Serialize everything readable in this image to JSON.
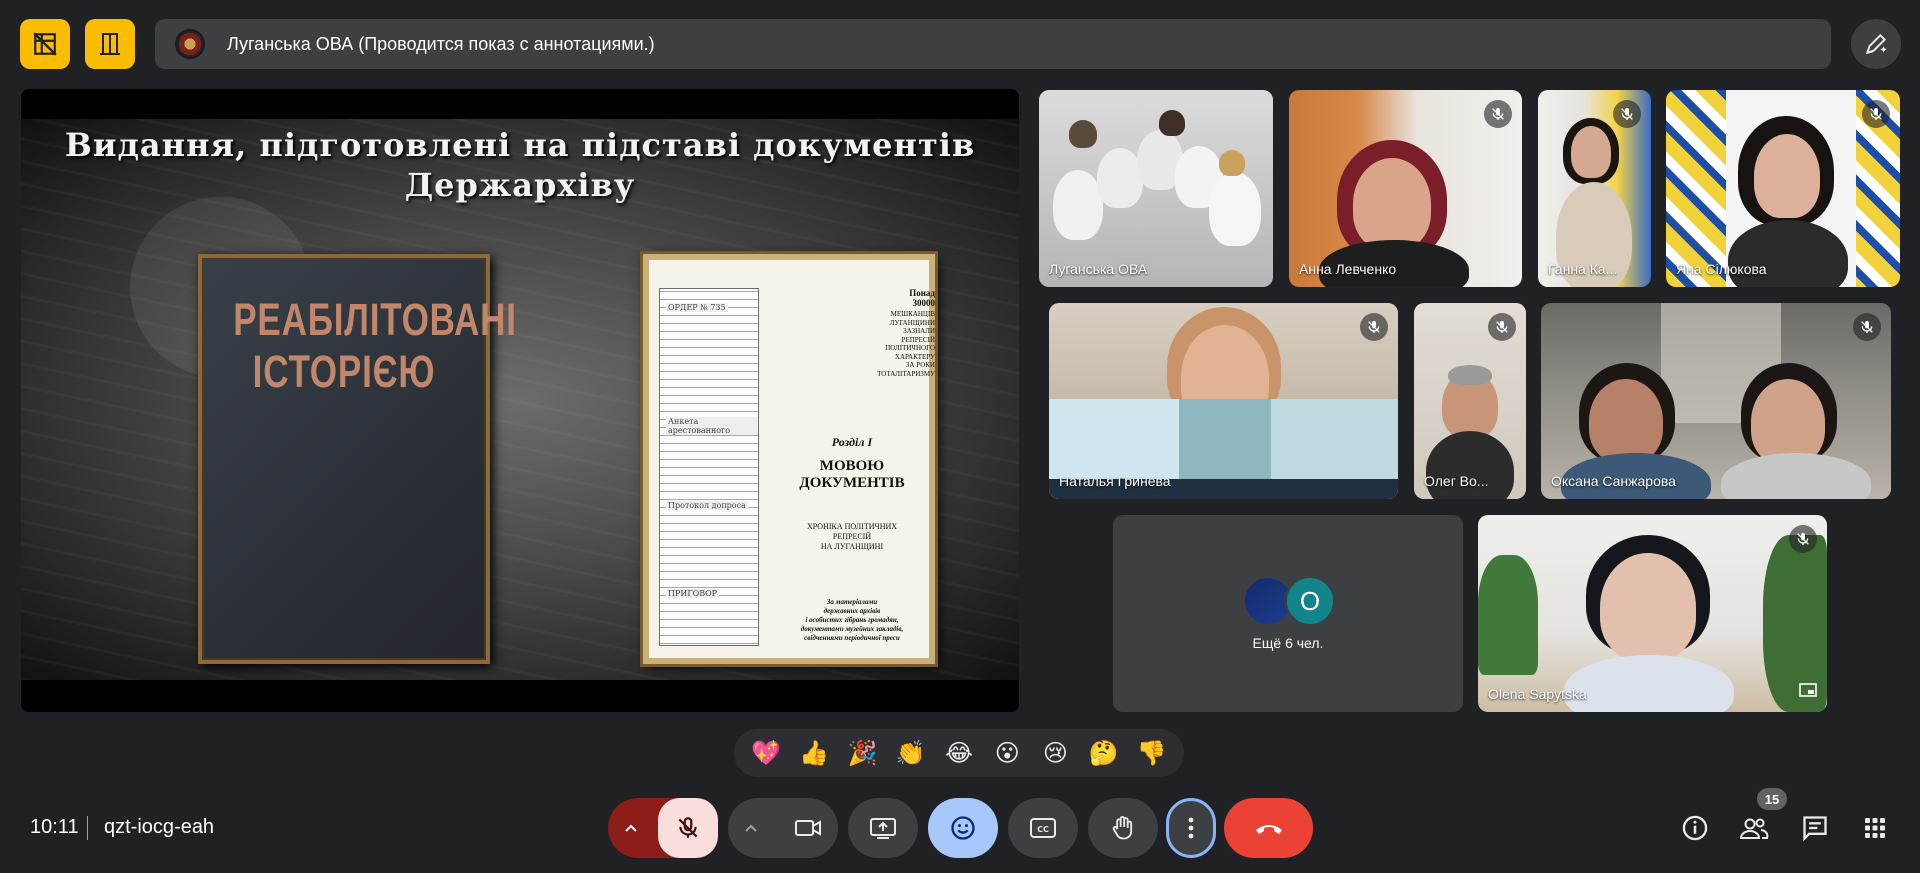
{
  "banner": {
    "text": "Луганська ОВА (Проводится показ с аннотациями.)"
  },
  "presentation": {
    "slide_title_line1": "Видання, підготовлені на підставі документів",
    "slide_title_line2": "Держархіву",
    "left_book_title_line1": "РЕАБІЛІТОВАНІ",
    "left_book_title_line2": "ІСТОРІЄЮ",
    "right_book": {
      "top_line1": "Понад",
      "top_line2": "30000",
      "top_line3": "МЕШКАНЦІВ",
      "top_line4": "ЛУГАНЩИНИ",
      "top_line5": "ЗАЗНАЛИ",
      "top_line6": "РЕПРЕСІЙ",
      "top_line7": "ПОЛІТИЧНОГО",
      "top_line8": "ХАРАКТЕРУ",
      "top_line9": "ЗА РОКИ",
      "top_line10": "ТОТАЛІТАРИЗМУ",
      "section": "Розділ І",
      "main_title_line1": "МОВОЮ",
      "main_title_line2": "ДОКУМЕНТІВ",
      "subtitle_line1": "ХРОНІКА ПОЛІТИЧНИХ",
      "subtitle_line2": "РЕПРЕСІЙ",
      "subtitle_line3": "НА ЛУГАНЩИНІ",
      "footer_line1": "За матеріалами",
      "footer_line2": "державних архівів",
      "footer_line3": "і особистих зібрань громадян,",
      "footer_line4": "документами музейних закладів,",
      "footer_line5": "свідченнями періодичної преси",
      "clip_labels": [
        "ОРДЕР № 735",
        "Анкета арестованного",
        "Протокол допроса",
        "ПРИГОВОР"
      ]
    }
  },
  "participants": [
    {
      "name": "Луганська ОВА"
    },
    {
      "name": "Анна Левченко"
    },
    {
      "name": "Ганна Ка..."
    },
    {
      "name": "Яна Сілюкова"
    },
    {
      "name": "Наталья Гринева"
    },
    {
      "name": "Олег Во..."
    },
    {
      "name": "Оксана Санжарова"
    },
    {
      "name": "Olena Sapytska"
    }
  ],
  "more_tile": {
    "avatar_letter": "O",
    "label": "Ещё 6 чел."
  },
  "reactions": [
    "💖",
    "👍",
    "🎉",
    "👏",
    "😂",
    "😮",
    "😢",
    "🤔",
    "👎"
  ],
  "bottom": {
    "time": "10:11",
    "meeting_code": "qzt-iocg-eah",
    "participants_count": "15"
  },
  "colors": {
    "background": "#202124",
    "accent_yellow": "#fbbc04",
    "mic_off_red": "#f9dedc",
    "hangup_red": "#ea4335",
    "reactions_active": "#a8c7fa"
  }
}
